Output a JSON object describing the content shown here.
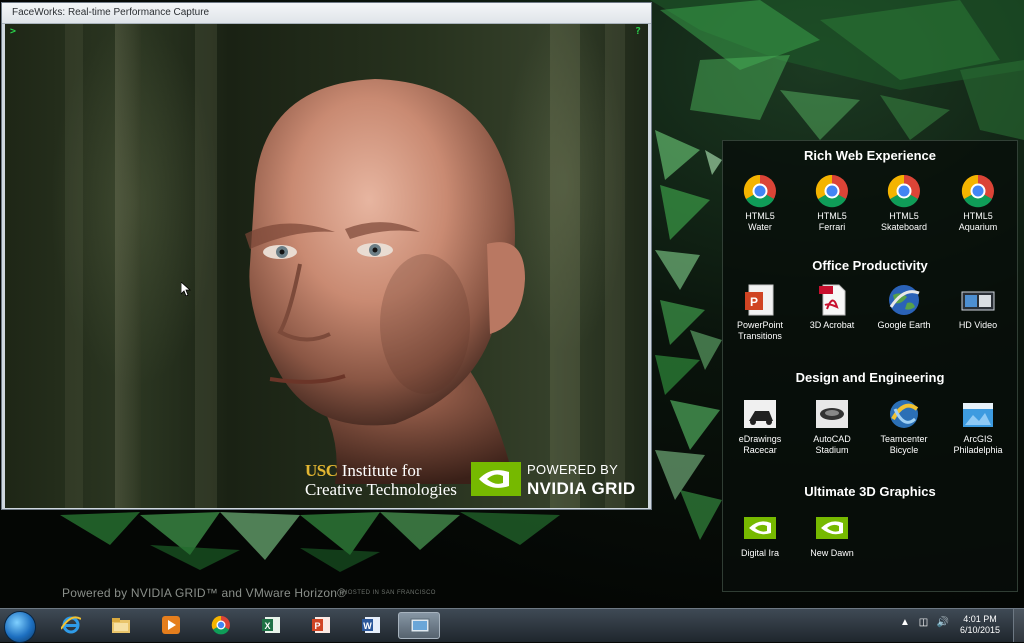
{
  "window": {
    "title": "FaceWorks: Real-time Performance Capture",
    "corner_marks": [
      ">",
      "?"
    ],
    "usc_logo": {
      "brand": "USC",
      "line1_rest": " Institute for",
      "line2": "Creative Technologies"
    },
    "nvidia_badge": {
      "line1": "POWERED BY",
      "line2": "NVIDIA GRID"
    }
  },
  "desktop": {
    "caption": "Powered by NVIDIA GRID™ and VMware Horizon®",
    "caption_small": "HOSTED IN SAN FRANCISCO"
  },
  "launcher": {
    "sections": [
      {
        "title": "Rich Web Experience",
        "items": [
          {
            "line1": "HTML5",
            "line2": "Water",
            "icon": "chrome-icon"
          },
          {
            "line1": "HTML5",
            "line2": "Ferrari",
            "icon": "chrome-icon"
          },
          {
            "line1": "HTML5",
            "line2": "Skateboard",
            "icon": "chrome-icon"
          },
          {
            "line1": "HTML5",
            "line2": "Aquarium",
            "icon": "chrome-icon"
          }
        ]
      },
      {
        "title": "Office Productivity",
        "items": [
          {
            "line1": "PowerPoint",
            "line2": "Transitions",
            "icon": "powerpoint-icon"
          },
          {
            "line1": "3D Acrobat",
            "line2": "",
            "icon": "acrobat-pdf-icon"
          },
          {
            "line1": "Google Earth",
            "line2": "",
            "icon": "google-earth-icon"
          },
          {
            "line1": "HD Video",
            "line2": "",
            "icon": "video-icon"
          }
        ]
      },
      {
        "title": "Design and Engineering",
        "items": [
          {
            "line1": "eDrawings",
            "line2": "Racecar",
            "icon": "edrawings-icon"
          },
          {
            "line1": "AutoCAD",
            "line2": "Stadium",
            "icon": "autocad-icon"
          },
          {
            "line1": "Teamcenter",
            "line2": "Bicycle",
            "icon": "teamcenter-icon"
          },
          {
            "line1": "ArcGIS",
            "line2": "Philadelphia",
            "icon": "arcgis-icon"
          }
        ]
      },
      {
        "title": "Ultimate 3D Graphics",
        "items": [
          {
            "line1": "Digital Ira",
            "line2": "",
            "icon": "nvidia-icon"
          },
          {
            "line1": "New Dawn",
            "line2": "",
            "icon": "nvidia-icon"
          }
        ]
      }
    ]
  },
  "taskbar": {
    "apps": [
      "internet-explorer-icon",
      "file-explorer-icon",
      "media-player-icon",
      "chrome-icon",
      "excel-icon",
      "powerpoint-icon",
      "word-icon",
      "remote-desktop-icon"
    ],
    "active_app": "remote-desktop-icon",
    "clock": {
      "time": "4:01 PM",
      "date": "6/10/2015"
    }
  },
  "colors": {
    "nvidia_green": "#76b900",
    "usc_gold": "#e3b632",
    "panel_bg": "#080e0a"
  }
}
